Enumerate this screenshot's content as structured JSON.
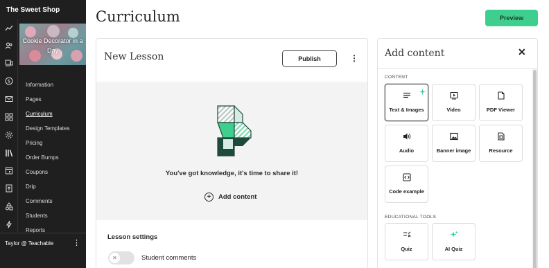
{
  "sidebar": {
    "brand": "The Sweet Shop",
    "course_title": "Cookie Decorator in a Day",
    "rail_icons": [
      "analytics-icon",
      "users-icon",
      "devices-icon",
      "dollar-icon",
      "mail-icon",
      "grid-icon",
      "gear-icon",
      "library-icon",
      "calendar-icon",
      "upload-icon",
      "shapes-icon",
      "bolt-icon"
    ],
    "nav_items": [
      {
        "label": "Information",
        "active": false
      },
      {
        "label": "Pages",
        "active": false
      },
      {
        "label": "Curriculum",
        "active": true
      },
      {
        "label": "Design Templates",
        "active": false
      },
      {
        "label": "Pricing",
        "active": false
      },
      {
        "label": "Order Bumps",
        "active": false
      },
      {
        "label": "Coupons",
        "active": false
      },
      {
        "label": "Drip",
        "active": false
      },
      {
        "label": "Comments",
        "active": false
      },
      {
        "label": "Students",
        "active": false
      },
      {
        "label": "Reports",
        "active": false
      }
    ],
    "user": "Taylor @ Teachable"
  },
  "header": {
    "title": "Curriculum",
    "preview_label": "Preview"
  },
  "lesson": {
    "title": "New Lesson",
    "publish_label": "Publish",
    "empty_message": "You've got knowledge, it's time to share it!",
    "add_content_label": "Add content",
    "settings_title": "Lesson settings",
    "student_comments_label": "Student comments",
    "student_comments_enabled": false
  },
  "panel": {
    "title": "Add content",
    "content_section": "CONTENT",
    "content_items": [
      {
        "label": "Text & Images",
        "icon": "text-lines-icon",
        "selected": true,
        "ai_badge": true
      },
      {
        "label": "Video",
        "icon": "video-play-icon",
        "selected": false
      },
      {
        "label": "PDF Viewer",
        "icon": "document-icon",
        "selected": false
      },
      {
        "label": "Audio",
        "icon": "speaker-icon",
        "selected": false
      },
      {
        "label": "Banner image",
        "icon": "image-icon",
        "selected": false
      },
      {
        "label": "Resource",
        "icon": "resource-file-icon",
        "selected": false
      },
      {
        "label": "Code example",
        "icon": "code-icon",
        "selected": false
      }
    ],
    "tools_section": "EDUCATIONAL TOOLS",
    "tools_items": [
      {
        "label": "Quiz",
        "icon": "quiz-icon"
      },
      {
        "label": "AI Quiz",
        "icon": "sparkle-icon"
      }
    ]
  },
  "colors": {
    "accent_green": "#3ecf8e",
    "sidebar_bg": "#1f1f1f",
    "illustration_dark": "#1e4a3c"
  }
}
